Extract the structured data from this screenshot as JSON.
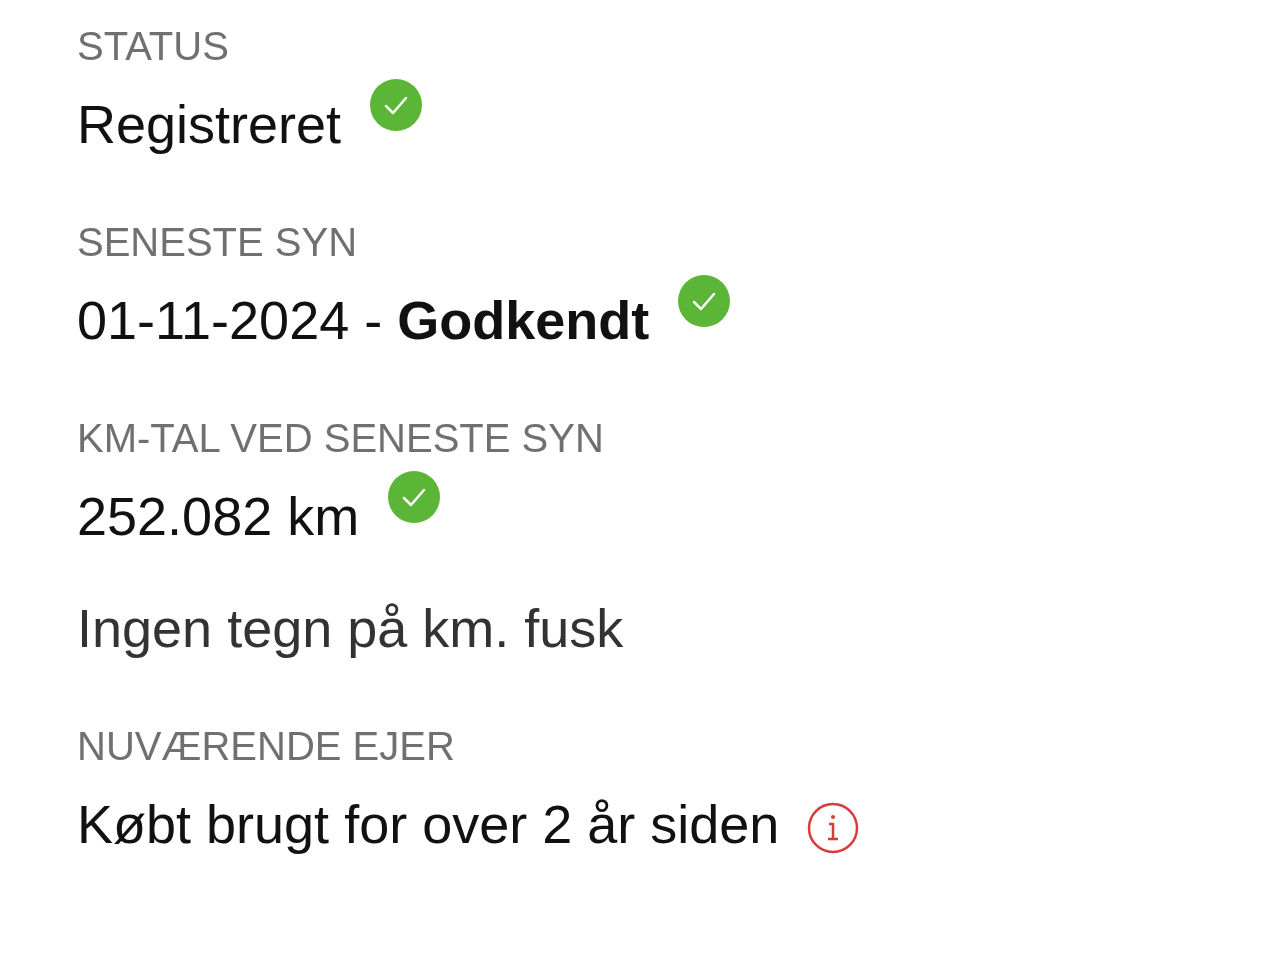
{
  "sections": [
    {
      "label": "STATUS",
      "rows": [
        {
          "kind": "verified",
          "text": "Registreret"
        }
      ]
    },
    {
      "label": "SENESTE SYN",
      "rows": [
        {
          "kind": "verified",
          "text": "01-11-2024 - **Godkendt**"
        }
      ]
    },
    {
      "label": "KM-TAL VED SENESTE SYN",
      "rows": [
        {
          "kind": "verified",
          "text": "252.082 km"
        },
        {
          "kind": "note",
          "text": "Ingen tegn på km. fusk"
        }
      ]
    },
    {
      "label": "NUVÆRENDE EJER",
      "rows": [
        {
          "kind": "info",
          "text": "Købt brugt for over 2 år siden"
        }
      ]
    }
  ]
}
